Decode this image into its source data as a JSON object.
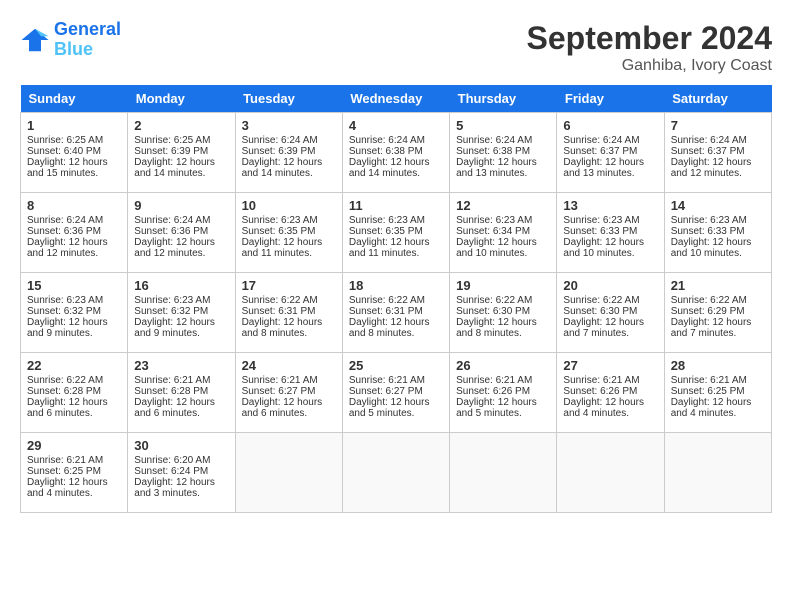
{
  "header": {
    "logo_line1": "General",
    "logo_line2": "Blue",
    "month": "September 2024",
    "location": "Ganhiba, Ivory Coast"
  },
  "columns": [
    "Sunday",
    "Monday",
    "Tuesday",
    "Wednesday",
    "Thursday",
    "Friday",
    "Saturday"
  ],
  "weeks": [
    [
      {
        "day": "1",
        "lines": [
          "Sunrise: 6:25 AM",
          "Sunset: 6:40 PM",
          "Daylight: 12 hours",
          "and 15 minutes."
        ]
      },
      {
        "day": "2",
        "lines": [
          "Sunrise: 6:25 AM",
          "Sunset: 6:39 PM",
          "Daylight: 12 hours",
          "and 14 minutes."
        ]
      },
      {
        "day": "3",
        "lines": [
          "Sunrise: 6:24 AM",
          "Sunset: 6:39 PM",
          "Daylight: 12 hours",
          "and 14 minutes."
        ]
      },
      {
        "day": "4",
        "lines": [
          "Sunrise: 6:24 AM",
          "Sunset: 6:38 PM",
          "Daylight: 12 hours",
          "and 14 minutes."
        ]
      },
      {
        "day": "5",
        "lines": [
          "Sunrise: 6:24 AM",
          "Sunset: 6:38 PM",
          "Daylight: 12 hours",
          "and 13 minutes."
        ]
      },
      {
        "day": "6",
        "lines": [
          "Sunrise: 6:24 AM",
          "Sunset: 6:37 PM",
          "Daylight: 12 hours",
          "and 13 minutes."
        ]
      },
      {
        "day": "7",
        "lines": [
          "Sunrise: 6:24 AM",
          "Sunset: 6:37 PM",
          "Daylight: 12 hours",
          "and 12 minutes."
        ]
      }
    ],
    [
      {
        "day": "8",
        "lines": [
          "Sunrise: 6:24 AM",
          "Sunset: 6:36 PM",
          "Daylight: 12 hours",
          "and 12 minutes."
        ]
      },
      {
        "day": "9",
        "lines": [
          "Sunrise: 6:24 AM",
          "Sunset: 6:36 PM",
          "Daylight: 12 hours",
          "and 12 minutes."
        ]
      },
      {
        "day": "10",
        "lines": [
          "Sunrise: 6:23 AM",
          "Sunset: 6:35 PM",
          "Daylight: 12 hours",
          "and 11 minutes."
        ]
      },
      {
        "day": "11",
        "lines": [
          "Sunrise: 6:23 AM",
          "Sunset: 6:35 PM",
          "Daylight: 12 hours",
          "and 11 minutes."
        ]
      },
      {
        "day": "12",
        "lines": [
          "Sunrise: 6:23 AM",
          "Sunset: 6:34 PM",
          "Daylight: 12 hours",
          "and 10 minutes."
        ]
      },
      {
        "day": "13",
        "lines": [
          "Sunrise: 6:23 AM",
          "Sunset: 6:33 PM",
          "Daylight: 12 hours",
          "and 10 minutes."
        ]
      },
      {
        "day": "14",
        "lines": [
          "Sunrise: 6:23 AM",
          "Sunset: 6:33 PM",
          "Daylight: 12 hours",
          "and 10 minutes."
        ]
      }
    ],
    [
      {
        "day": "15",
        "lines": [
          "Sunrise: 6:23 AM",
          "Sunset: 6:32 PM",
          "Daylight: 12 hours",
          "and 9 minutes."
        ]
      },
      {
        "day": "16",
        "lines": [
          "Sunrise: 6:23 AM",
          "Sunset: 6:32 PM",
          "Daylight: 12 hours",
          "and 9 minutes."
        ]
      },
      {
        "day": "17",
        "lines": [
          "Sunrise: 6:22 AM",
          "Sunset: 6:31 PM",
          "Daylight: 12 hours",
          "and 8 minutes."
        ]
      },
      {
        "day": "18",
        "lines": [
          "Sunrise: 6:22 AM",
          "Sunset: 6:31 PM",
          "Daylight: 12 hours",
          "and 8 minutes."
        ]
      },
      {
        "day": "19",
        "lines": [
          "Sunrise: 6:22 AM",
          "Sunset: 6:30 PM",
          "Daylight: 12 hours",
          "and 8 minutes."
        ]
      },
      {
        "day": "20",
        "lines": [
          "Sunrise: 6:22 AM",
          "Sunset: 6:30 PM",
          "Daylight: 12 hours",
          "and 7 minutes."
        ]
      },
      {
        "day": "21",
        "lines": [
          "Sunrise: 6:22 AM",
          "Sunset: 6:29 PM",
          "Daylight: 12 hours",
          "and 7 minutes."
        ]
      }
    ],
    [
      {
        "day": "22",
        "lines": [
          "Sunrise: 6:22 AM",
          "Sunset: 6:28 PM",
          "Daylight: 12 hours",
          "and 6 minutes."
        ]
      },
      {
        "day": "23",
        "lines": [
          "Sunrise: 6:21 AM",
          "Sunset: 6:28 PM",
          "Daylight: 12 hours",
          "and 6 minutes."
        ]
      },
      {
        "day": "24",
        "lines": [
          "Sunrise: 6:21 AM",
          "Sunset: 6:27 PM",
          "Daylight: 12 hours",
          "and 6 minutes."
        ]
      },
      {
        "day": "25",
        "lines": [
          "Sunrise: 6:21 AM",
          "Sunset: 6:27 PM",
          "Daylight: 12 hours",
          "and 5 minutes."
        ]
      },
      {
        "day": "26",
        "lines": [
          "Sunrise: 6:21 AM",
          "Sunset: 6:26 PM",
          "Daylight: 12 hours",
          "and 5 minutes."
        ]
      },
      {
        "day": "27",
        "lines": [
          "Sunrise: 6:21 AM",
          "Sunset: 6:26 PM",
          "Daylight: 12 hours",
          "and 4 minutes."
        ]
      },
      {
        "day": "28",
        "lines": [
          "Sunrise: 6:21 AM",
          "Sunset: 6:25 PM",
          "Daylight: 12 hours",
          "and 4 minutes."
        ]
      }
    ],
    [
      {
        "day": "29",
        "lines": [
          "Sunrise: 6:21 AM",
          "Sunset: 6:25 PM",
          "Daylight: 12 hours",
          "and 4 minutes."
        ]
      },
      {
        "day": "30",
        "lines": [
          "Sunrise: 6:20 AM",
          "Sunset: 6:24 PM",
          "Daylight: 12 hours",
          "and 3 minutes."
        ]
      },
      null,
      null,
      null,
      null,
      null
    ]
  ]
}
